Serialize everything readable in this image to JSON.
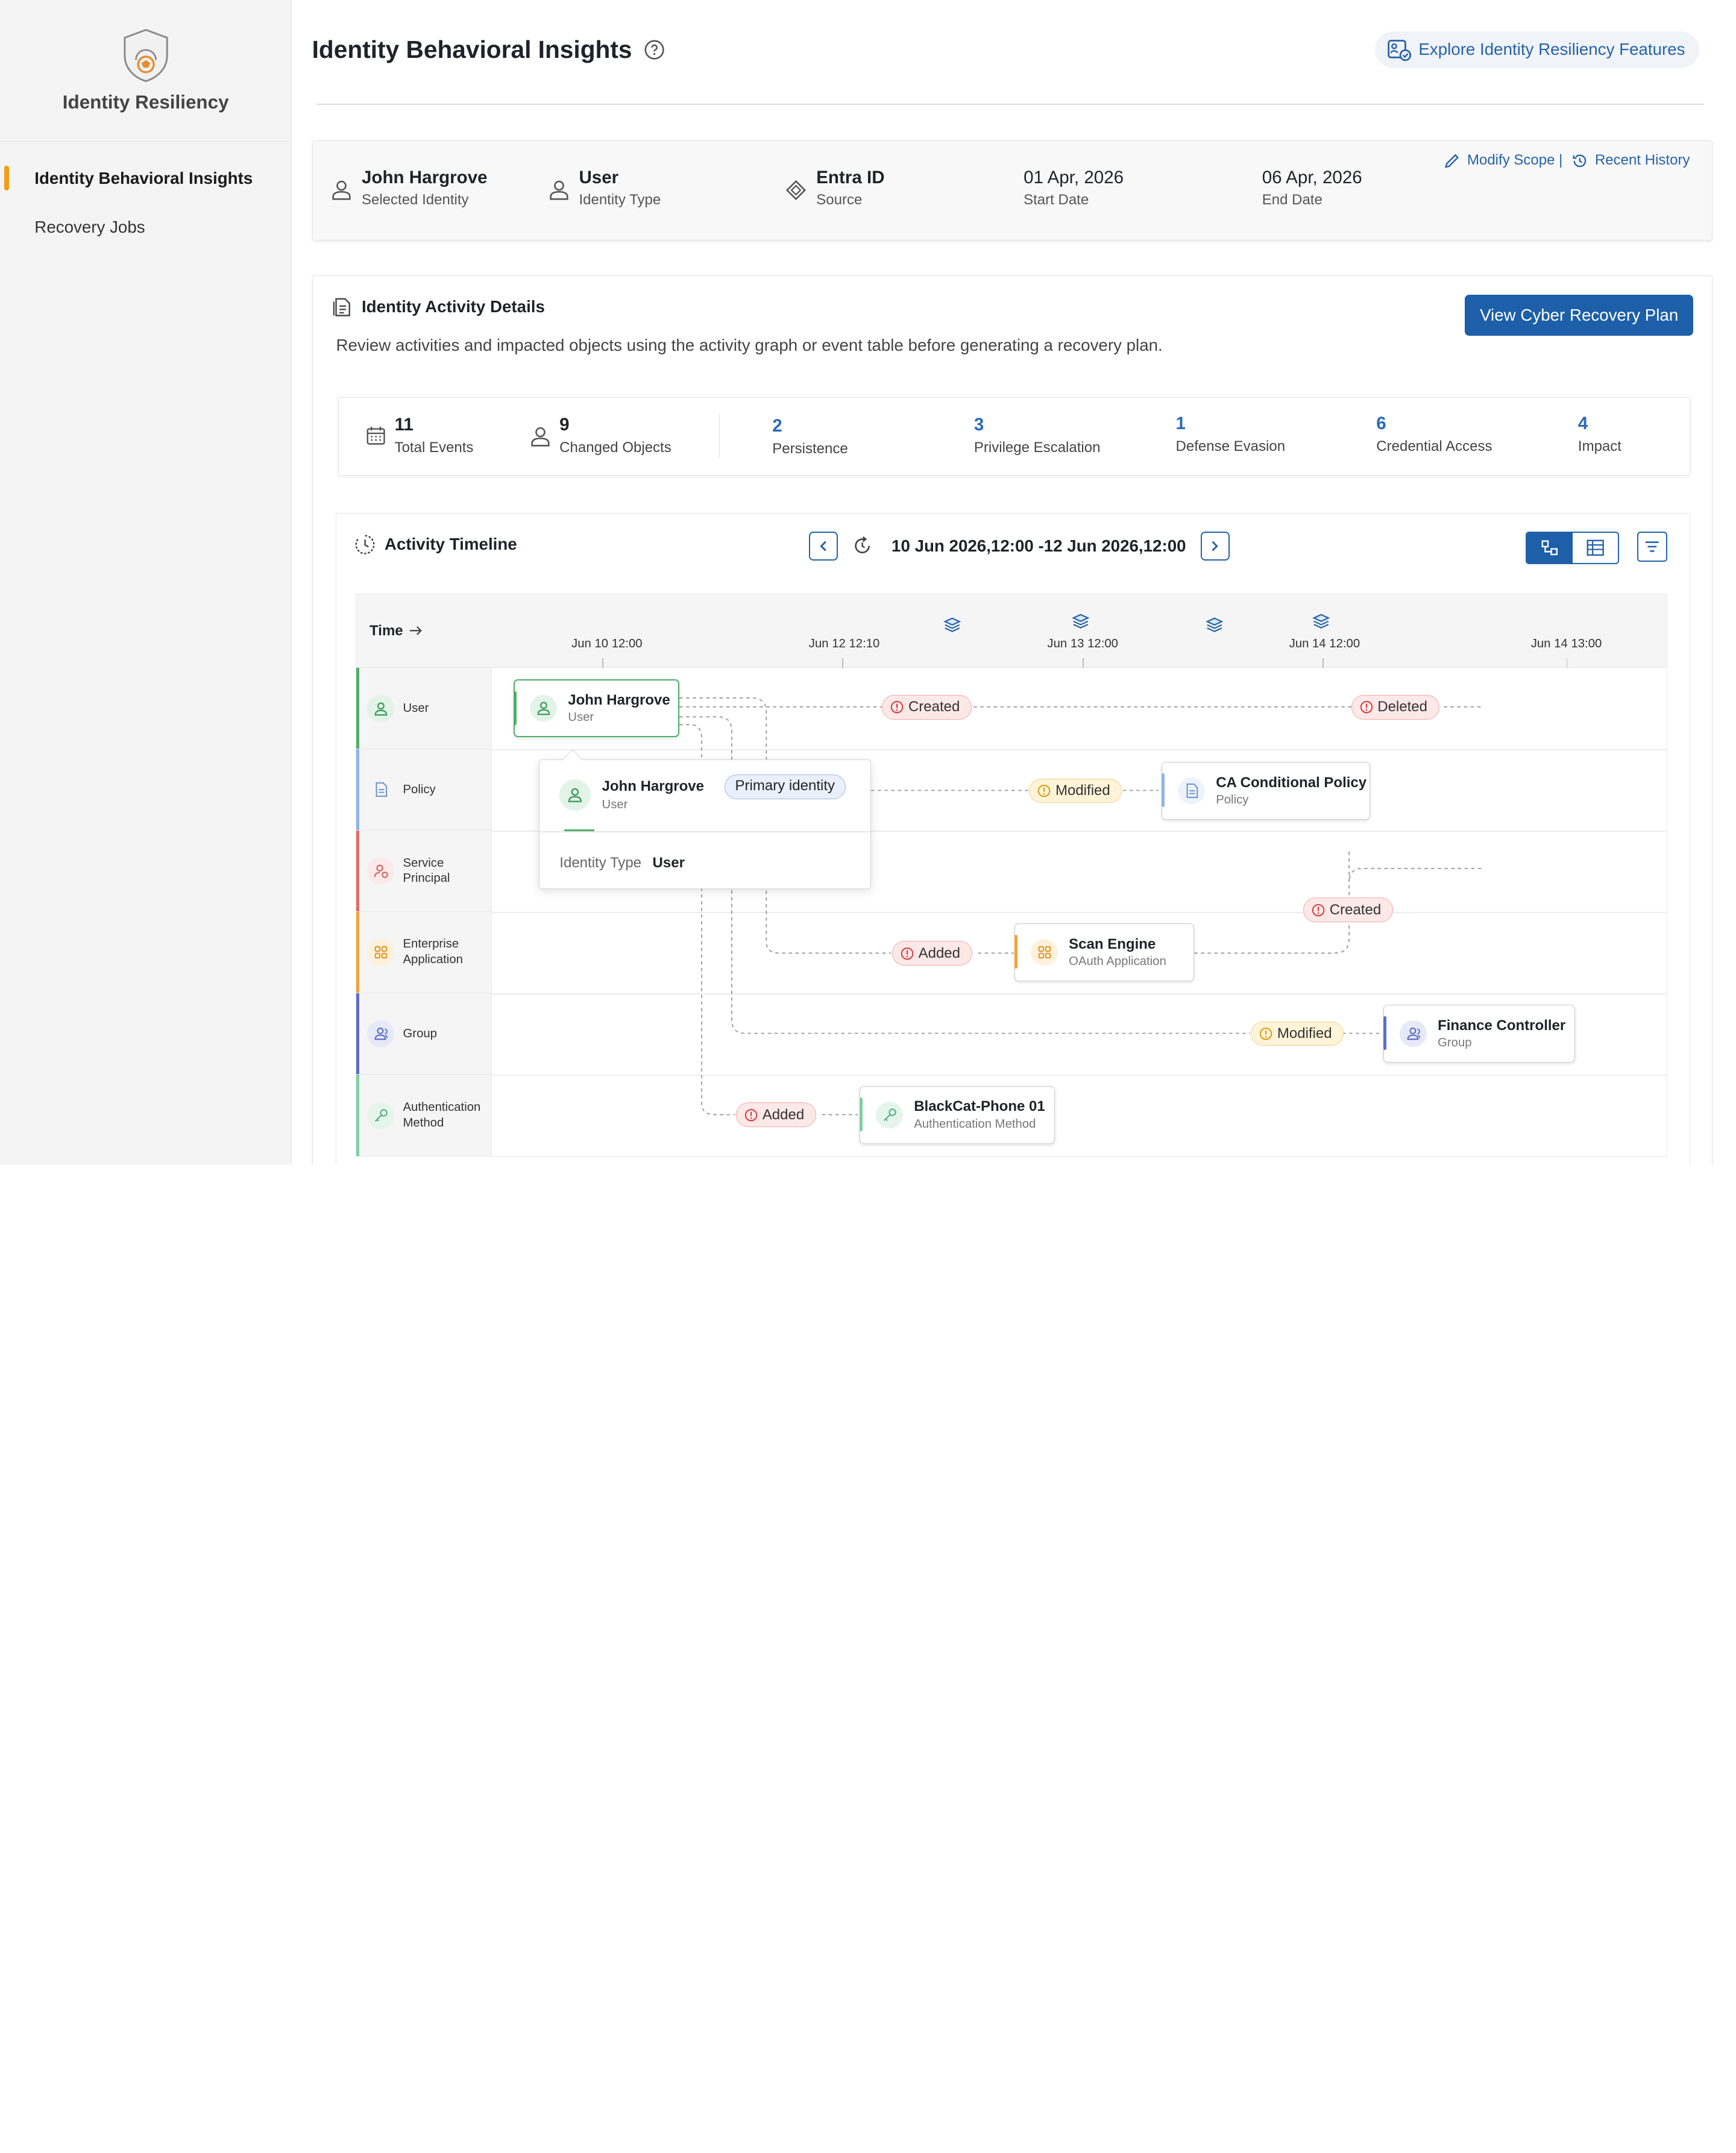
{
  "sidebar": {
    "app_title": "Identity Resiliency",
    "items": [
      {
        "label": "Identity Behavioral Insights",
        "active": true
      },
      {
        "label": "Recovery Jobs",
        "active": false
      }
    ]
  },
  "header": {
    "title": "Identity Behavioral Insights",
    "explore_label": "Explore Identity Resiliency Features"
  },
  "scope": {
    "identity": {
      "value": "John Hargrove",
      "label": "Selected Identity"
    },
    "identity_type": {
      "value": "User",
      "label": "Identity Type"
    },
    "source": {
      "value": "Entra ID",
      "label": "Source"
    },
    "start_date": {
      "value": "01 Apr, 2026",
      "label": "Start Date"
    },
    "end_date": {
      "value": "06 Apr, 2026",
      "label": "End Date"
    },
    "modify_label": "Modify Scope |",
    "history_label": "Recent History"
  },
  "activity": {
    "title": "Identity Activity Details",
    "description": "Review activities and impacted objects using the activity graph or event table before generating a recovery plan.",
    "recovery_button": "View Cyber Recovery Plan",
    "stats": [
      {
        "count": "11",
        "label": "Total Events"
      },
      {
        "count": "9",
        "label": "Changed Objects"
      },
      {
        "count": "2",
        "label": "Persistence"
      },
      {
        "count": "3",
        "label": "Privilege Escalation"
      },
      {
        "count": "1",
        "label": "Defense Evasion"
      },
      {
        "count": "6",
        "label": "Credential Access"
      },
      {
        "count": "4",
        "label": "Impact"
      }
    ]
  },
  "timeline": {
    "title": "Activity Timeline",
    "range": "10 Jun 2026,12:00 -12 Jun 2026,12:00",
    "time_label": "Time",
    "ticks": [
      "Jun 10 12:00",
      "Jun 12 12:10",
      "Jun 13 12:00",
      "Jun 14 12:00",
      "Jun 14 13:00"
    ],
    "rows": [
      {
        "label": "User",
        "icon": "user-icon",
        "color": "#4fae6a"
      },
      {
        "label": "Policy",
        "icon": "document-icon",
        "color": "#8fb3e6"
      },
      {
        "label": "Service\nPrincipal",
        "icon": "service-principal-icon",
        "color": "#e26b6b"
      },
      {
        "label": "Enterprise\nApplication",
        "icon": "app-grid-icon",
        "color": "#f0a33a"
      },
      {
        "label": "Group",
        "icon": "group-icon",
        "color": "#5b6ec9"
      },
      {
        "label": "Authentication\nMethod",
        "icon": "key-icon",
        "color": "#7fcfa3"
      }
    ],
    "nodes": {
      "user": {
        "title": "John Hargrove",
        "subtitle": "User"
      },
      "policy": {
        "title": "CA Conditional Policy",
        "subtitle": "Policy"
      },
      "app": {
        "title": "Scan Engine",
        "subtitle": "OAuth Application"
      },
      "group": {
        "title": "Finance Controller",
        "subtitle": "Group"
      },
      "auth": {
        "title": "BlackCat-Phone 01",
        "subtitle": "Authentication Method"
      }
    },
    "badges": {
      "created1": "Created",
      "deleted": "Deleted",
      "modified1": "Modified",
      "created2": "Created",
      "added1": "Added",
      "modified2": "Modified",
      "added2": "Added"
    },
    "popup": {
      "title": "John Hargrove",
      "subtitle": "User",
      "pill": "Primary identity",
      "key": "Identity Type",
      "value": "User"
    }
  }
}
